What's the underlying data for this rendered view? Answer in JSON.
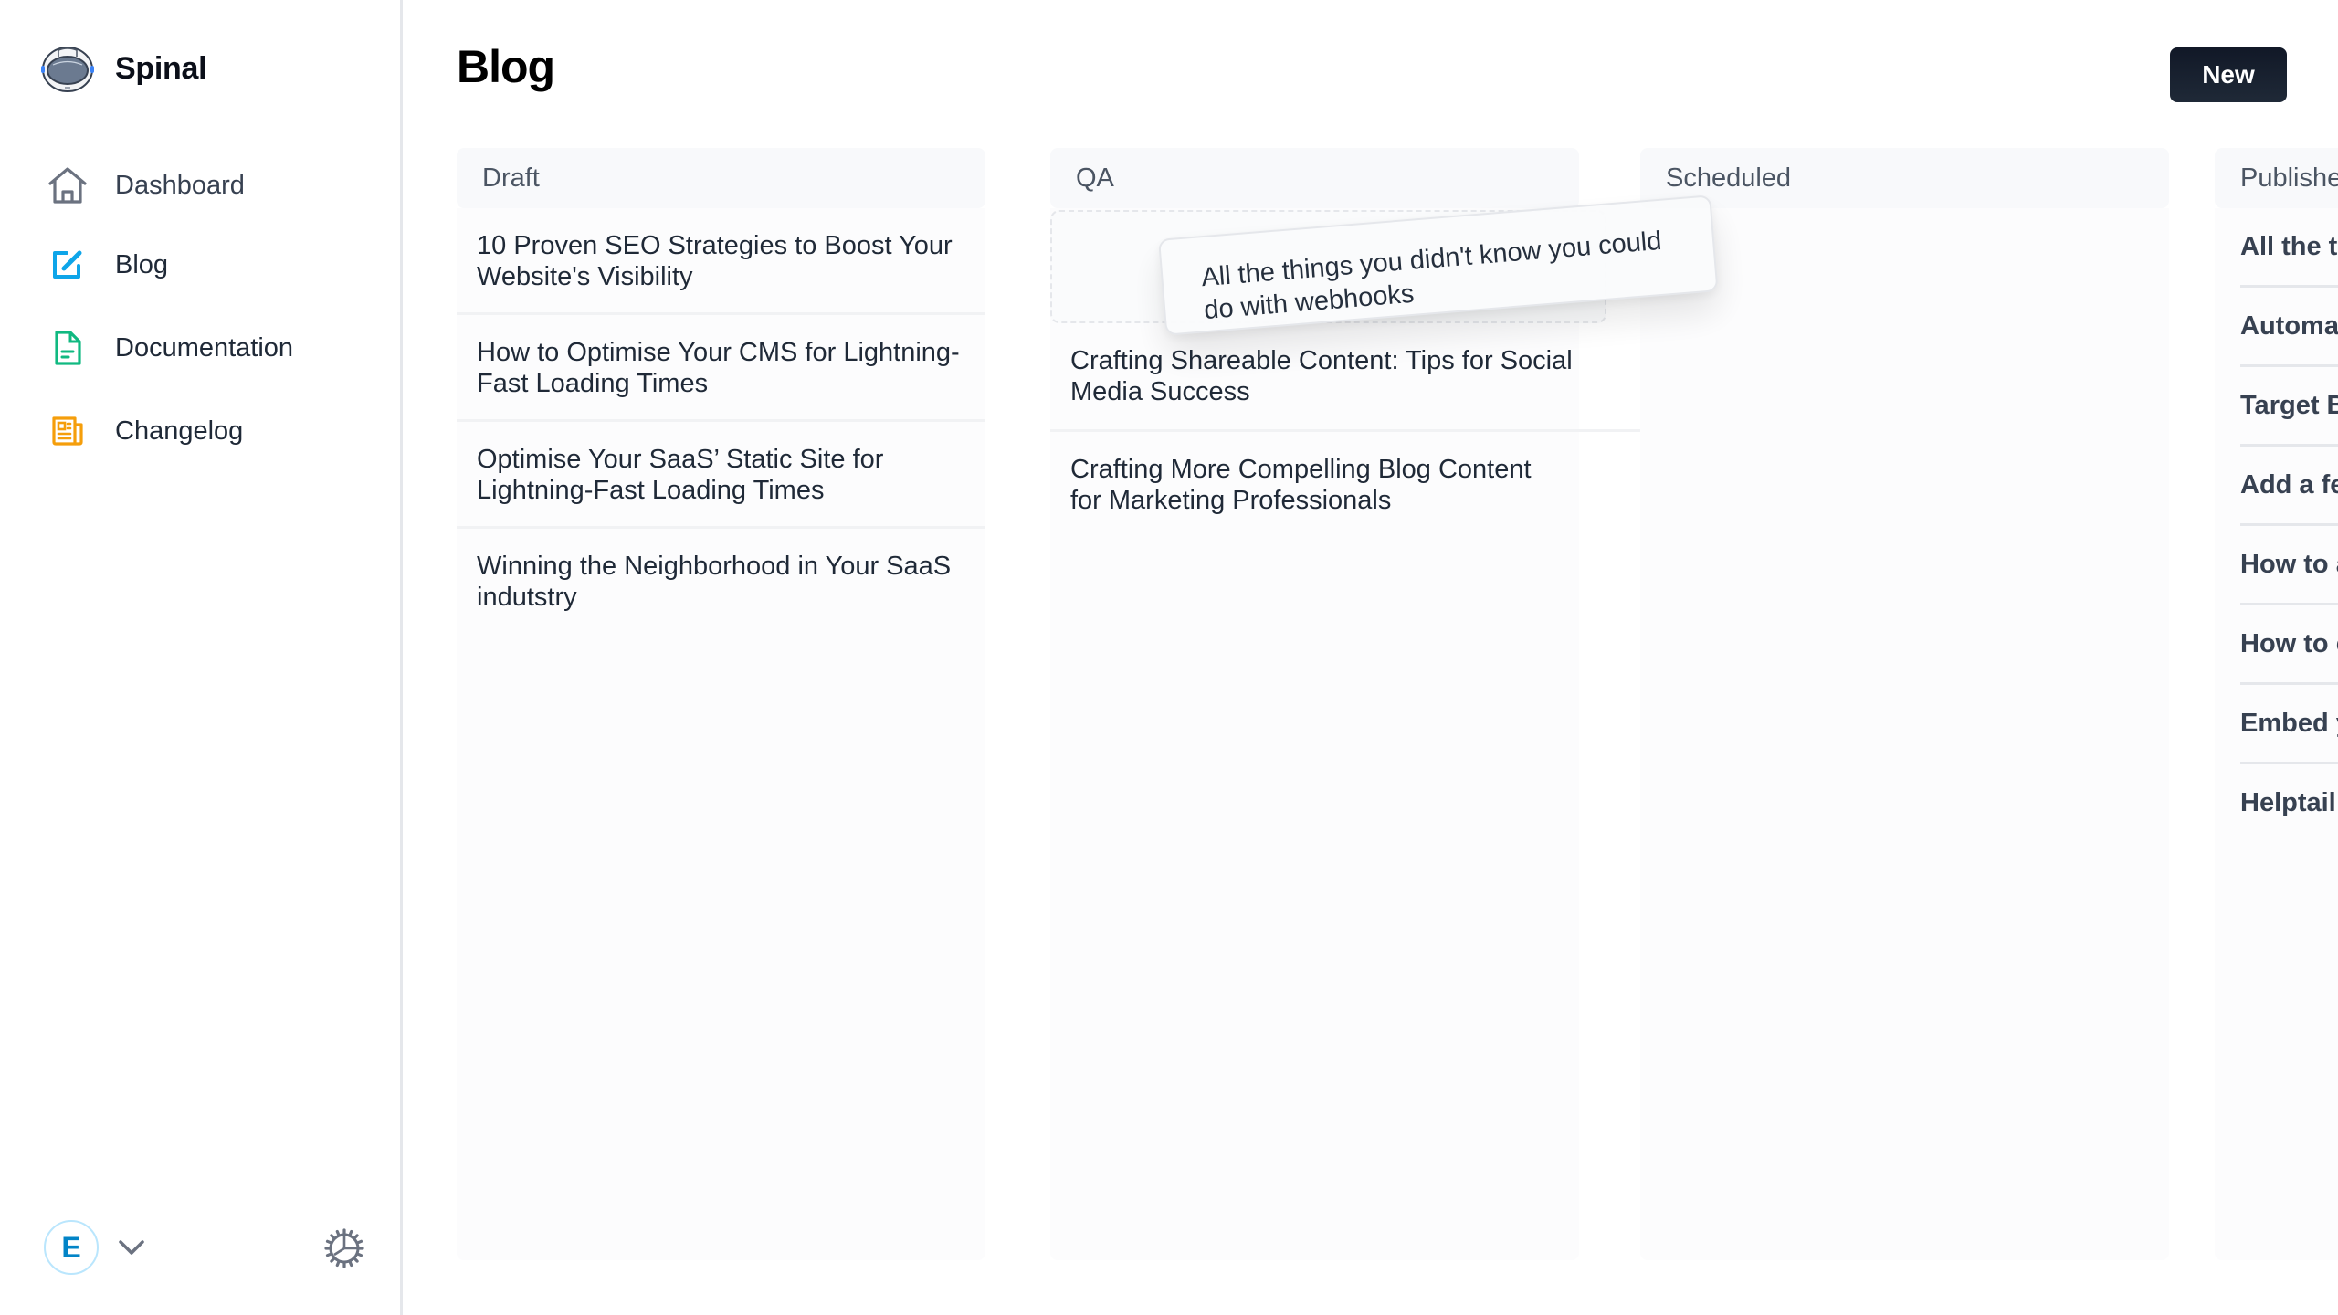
{
  "app": {
    "name": "Spinal",
    "logo_icon": "astronaut-helmet-icon"
  },
  "sidebar": {
    "items": [
      {
        "label": "Dashboard",
        "icon": "home-icon",
        "color": "#6b7280",
        "active": false
      },
      {
        "label": "Blog",
        "icon": "edit-icon",
        "color": "#0ea5e9",
        "active": true
      },
      {
        "label": "Documentation",
        "icon": "document-icon",
        "color": "#10b981",
        "active": false
      },
      {
        "label": "Changelog",
        "icon": "newspaper-icon",
        "color": "#f59e0b",
        "active": false
      }
    ],
    "footer": {
      "avatar_initial": "E",
      "avatar_color": "#0284c7",
      "menu_icon": "chevron-down-icon",
      "settings_icon": "gear-icon"
    }
  },
  "header": {
    "title": "Blog",
    "new_button_label": "New"
  },
  "board": {
    "columns": [
      {
        "title": "Draft",
        "cards": [
          "10 Proven SEO Strategies to Boost Your Website's Visibility",
          "How to Optimise Your CMS for Lightning-Fast Loading Times",
          "Optimise Your SaaS’ Static Site for Lightning-Fast Loading Times",
          "Winning the Neighborhood in Your SaaS indutstry"
        ]
      },
      {
        "title": "QA",
        "cards": [
          "Crafting Shareable Content: Tips for Social Media Success",
          "Crafting More Compelling Blog Content for Marketing Professionals"
        ]
      },
      {
        "title": "Scheduled",
        "cards": []
      },
      {
        "title": "Published",
        "cards": [
          "All the things you didn't know you could do with webhooks",
          "Automate",
          "Target B",
          "Add a fe",
          "How to a",
          "How to e",
          "Embed y",
          "Helptail"
        ]
      }
    ],
    "dragging_card": "All the things you didn't know you could do with webhooks"
  }
}
